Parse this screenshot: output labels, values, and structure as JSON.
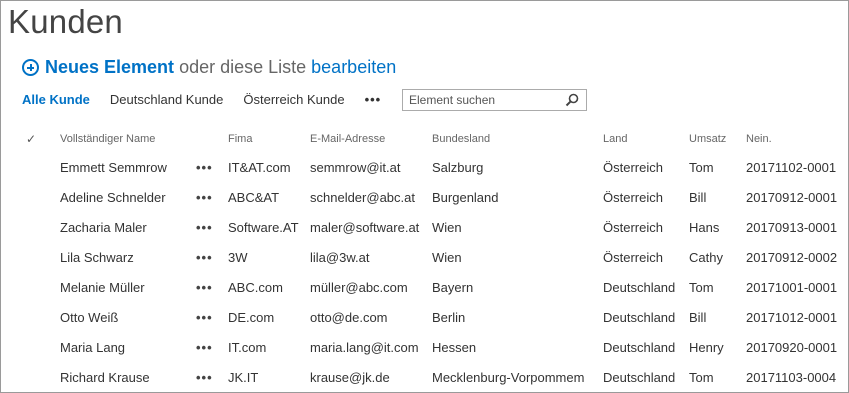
{
  "page": {
    "title": "Kunden"
  },
  "new_item": {
    "label": "Neues Element",
    "middle": "oder diese Liste",
    "edit": "bearbeiten"
  },
  "views": {
    "items": [
      "Alle Kunde",
      "Deutschland Kunde",
      "Österreich Kunde"
    ],
    "more": "•••"
  },
  "search": {
    "placeholder": "Element suchen"
  },
  "table": {
    "check_header": "✓",
    "headers": {
      "name": "Vollständiger Name",
      "fima": "Fima",
      "email": "E-Mail-Adresse",
      "state": "Bundesland",
      "land": "Land",
      "umsatz": "Umsatz",
      "nr": "Nein."
    },
    "row_menu": "•••",
    "rows": [
      {
        "name": "Emmett Semmrow",
        "fima": "IT&AT.com",
        "email": "semmrow@it.at",
        "state": "Salzburg",
        "land": "Österreich",
        "umsatz": "Tom",
        "nr": "20171102-0001"
      },
      {
        "name": "Adeline Schnelder",
        "fima": "ABC&AT",
        "email": "schnelder@abc.at",
        "state": "Burgenland",
        "land": "Österreich",
        "umsatz": "Bill",
        "nr": "20170912-0001"
      },
      {
        "name": "Zacharia Maler",
        "fima": "Software.AT",
        "email": "maler@software.at",
        "state": "Wien",
        "land": "Österreich",
        "umsatz": "Hans",
        "nr": "20170913-0001"
      },
      {
        "name": "Lila Schwarz",
        "fima": "3W",
        "email": "lila@3w.at",
        "state": "Wien",
        "land": "Österreich",
        "umsatz": "Cathy",
        "nr": "20170912-0002"
      },
      {
        "name": "Melanie Müller",
        "fima": "ABC.com",
        "email": "müller@abc.com",
        "state": "Bayern",
        "land": "Deutschland",
        "umsatz": "Tom",
        "nr": "20171001-0001"
      },
      {
        "name": "Otto Weiß",
        "fima": "DE.com",
        "email": "otto@de.com",
        "state": "Berlin",
        "land": "Deutschland",
        "umsatz": "Bill",
        "nr": "20171012-0001"
      },
      {
        "name": "Maria Lang",
        "fima": "IT.com",
        "email": "maria.lang@it.com",
        "state": "Hessen",
        "land": "Deutschland",
        "umsatz": "Henry",
        "nr": "20170920-0001"
      },
      {
        "name": "Richard Krause",
        "fima": "JK.IT",
        "email": "krause@jk.de",
        "state": "Mecklenburg-Vorpommem",
        "land": "Deutschland",
        "umsatz": "Tom",
        "nr": "20171103-0004"
      }
    ]
  },
  "colors": {
    "link": "#0072c6",
    "text": "#333333",
    "muted": "#666666",
    "border": "#9a9a9a"
  }
}
